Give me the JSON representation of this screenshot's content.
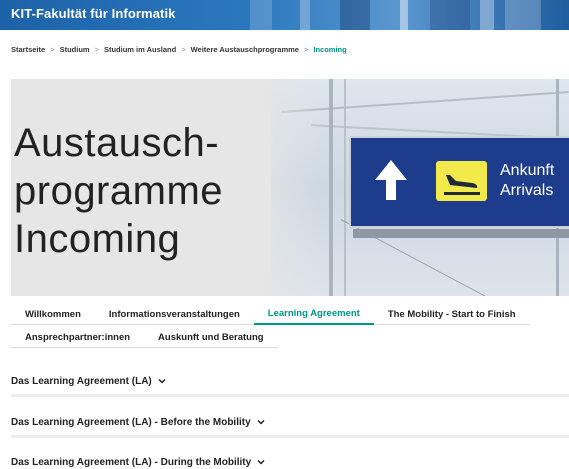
{
  "header": {
    "brand": "KIT-Fakultät für Informatik"
  },
  "breadcrumb": {
    "items": [
      "Startseite",
      "Studium",
      "Studium im Ausland",
      "Weitere Austauschprogramme"
    ],
    "current": "Incoming",
    "separator": ">"
  },
  "hero": {
    "title": "Austausch-\nprogramme\nIncoming",
    "sign_text_de": "Ankunft",
    "sign_text_en": "Arrivals"
  },
  "tabs": {
    "row1": [
      "Willkommen",
      "Informationsveranstaltungen",
      "Learning Agreement",
      "The Mobility - Start to Finish"
    ],
    "row2": [
      "Ansprechpartner:innen",
      "Auskunft und Beratung"
    ],
    "active": "Learning Agreement"
  },
  "accordions": [
    "Das Learning Agreement (LA)",
    "Das Learning Agreement (LA) - Before the Mobility",
    "Das Learning Agreement (LA) - During the Mobility"
  ],
  "colors": {
    "accent": "#009682",
    "header_blue": "#2c78bf",
    "sign_blue": "#1e3c8c",
    "sign_yellow": "#f2ea4a"
  },
  "icons": {
    "chevron": "chevron-down-icon",
    "arrow": "arrow-up-icon",
    "plane": "plane-landing-icon"
  }
}
